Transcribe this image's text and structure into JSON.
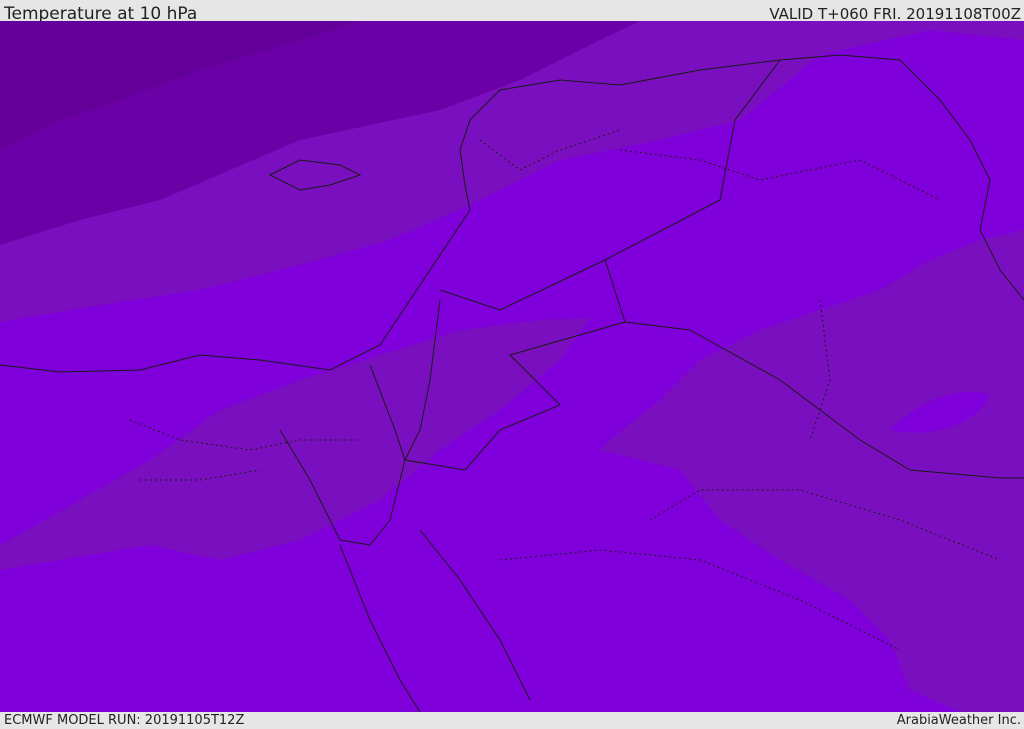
{
  "header": {
    "title": "Temperature at 10 hPa",
    "valid_time": "VALID T+060 FRI. 20191108T00Z"
  },
  "footer": {
    "model_run": "ECMWF MODEL RUN: 20191105T12Z",
    "credit": "ArabiaWeather Inc."
  },
  "colors": {
    "band_darkest": "#620099",
    "band_dark": "#6b00a6",
    "band_mid": "#7a0fbf",
    "band_light": "#8000db",
    "band_lower": "#7c0ad1",
    "lines": "#1a1a1a"
  }
}
